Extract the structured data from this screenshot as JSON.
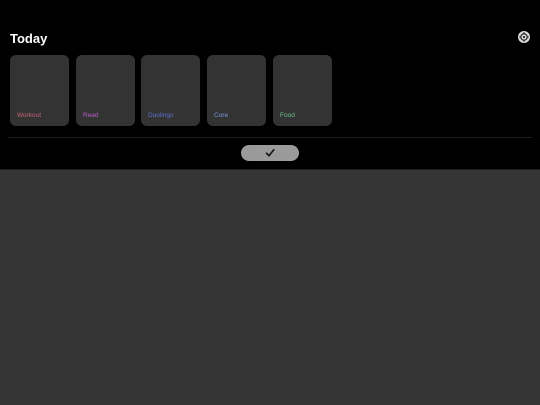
{
  "header": {
    "title": "Today"
  },
  "habits": [
    {
      "label": "Workout",
      "color": "#c4647a"
    },
    {
      "label": "Read",
      "color": "#b45bc2"
    },
    {
      "label": "Duolingo",
      "color": "#5f6fd2"
    },
    {
      "label": "Core",
      "color": "#7f9bd9"
    },
    {
      "label": "Food",
      "color": "#6bc48a"
    }
  ],
  "icons": {
    "settings": "gear-icon",
    "confirm": "checkmark-icon"
  },
  "colors": {
    "background": "#000000",
    "card": "#333333",
    "lower_panel": "#353535",
    "confirm_button": "#9a9a9a"
  }
}
